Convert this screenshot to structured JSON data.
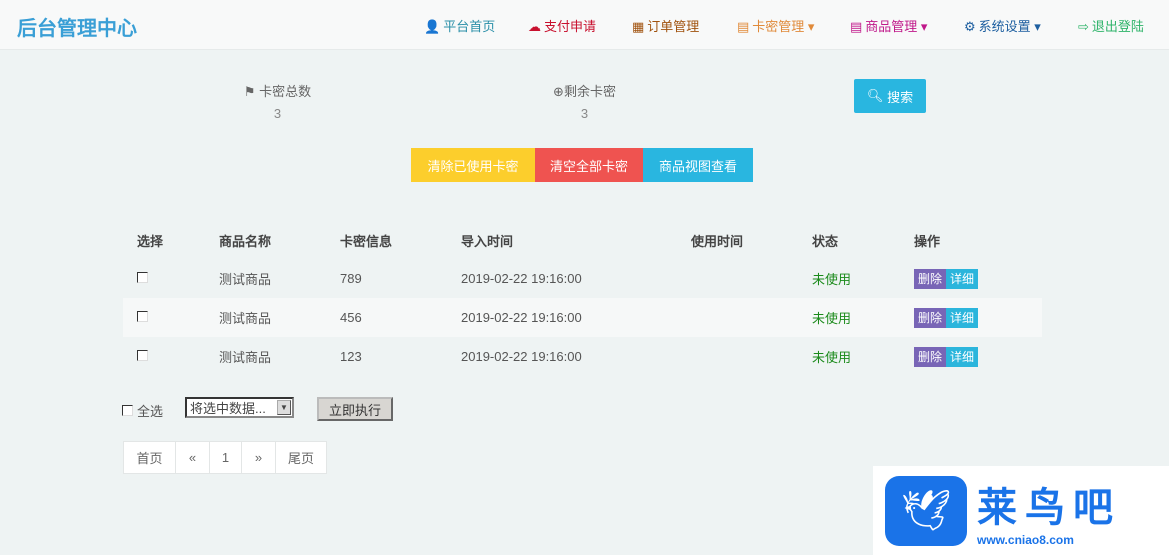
{
  "header": {
    "brand": "后台管理中心",
    "nav": [
      {
        "label": "平台首页",
        "icon": "user-icon",
        "color": "#2a8fa8"
      },
      {
        "label": "支付申请",
        "icon": "cloud-icon",
        "color": "#c8102e"
      },
      {
        "label": "订单管理",
        "icon": "calendar-icon",
        "color": "#a0520e"
      },
      {
        "label": "卡密管理",
        "icon": "list-icon",
        "color": "#e08a3a",
        "dropdown": true
      },
      {
        "label": "商品管理",
        "icon": "list-icon",
        "color": "#c0188a",
        "dropdown": true
      },
      {
        "label": "系统设置",
        "icon": "gear-icon",
        "color": "#1e5fa0",
        "dropdown": true
      },
      {
        "label": "退出登陆",
        "icon": "sign-out-icon",
        "color": "#2fb46a"
      }
    ]
  },
  "stats": {
    "total_label": "卡密总数",
    "total_value": "3",
    "remain_label": "剩余卡密",
    "remain_value": "3",
    "search": "搜索"
  },
  "actions": {
    "clear_used": "清除已使用卡密",
    "clear_all": "清空全部卡密",
    "view": "商品视图查看"
  },
  "colors": {
    "yellow": "#fcce2c",
    "red": "#ef5350",
    "blue": "#29b6e0",
    "purple": "#7865b6"
  },
  "table": {
    "headers": [
      "选择",
      "商品名称",
      "卡密信息",
      "导入时间",
      "使用时间",
      "状态",
      "操作"
    ],
    "rows": [
      {
        "name": "测试商品",
        "card": "789",
        "import": "2019-02-22 19:16:00",
        "used": "",
        "status": "未使用"
      },
      {
        "name": "测试商品",
        "card": "456",
        "import": "2019-02-22 19:16:00",
        "used": "",
        "status": "未使用"
      },
      {
        "name": "测试商品",
        "card": "123",
        "import": "2019-02-22 19:16:00",
        "used": "",
        "status": "未使用"
      }
    ],
    "delete": "删除",
    "detail": "详细"
  },
  "bulk": {
    "select_all": "全选",
    "select_value": "将选中数据...",
    "execute": "立即执行"
  },
  "pagination": {
    "first": "首页",
    "prev": "«",
    "page": "1",
    "next": "»",
    "last": "尾页"
  },
  "watermark": {
    "text": "莱鸟吧",
    "url": "www.cniao8.com"
  }
}
